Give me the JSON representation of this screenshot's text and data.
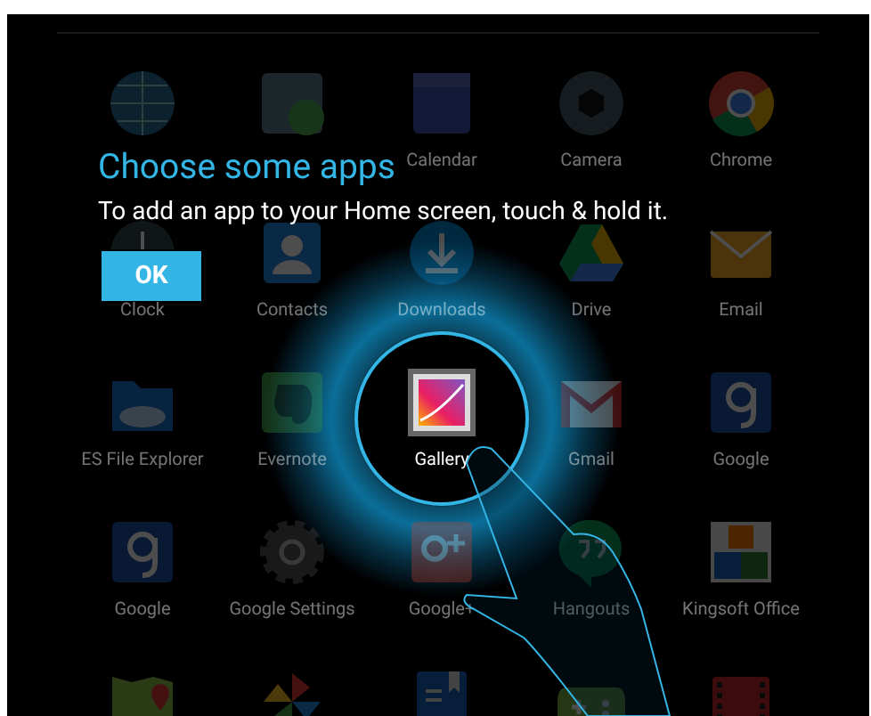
{
  "apps": [
    {
      "highlighted": false
    },
    {
      "highlighted": false
    },
    {
      "label": "Calendar",
      "highlighted": false
    },
    {
      "label": "Camera",
      "highlighted": false
    },
    {
      "label": "Chrome",
      "highlighted": false
    },
    {
      "label": "Clock",
      "highlighted": false
    },
    {
      "label": "Contacts",
      "highlighted": false
    },
    {
      "label": "Downloads",
      "highlighted": false
    },
    {
      "label": "Drive",
      "highlighted": false
    },
    {
      "label": "Email",
      "highlighted": false
    },
    {
      "label": "ES File Explorer",
      "highlighted": false
    },
    {
      "label": "Evernote",
      "highlighted": false
    },
    {
      "label": "Gallery",
      "highlighted": true
    },
    {
      "label": "Gmail",
      "highlighted": false
    },
    {
      "label": "Google",
      "highlighted": false
    },
    {
      "label": "Google",
      "highlighted": false
    },
    {
      "label": "Google Settings",
      "highlighted": false
    },
    {
      "label": "Google+",
      "highlighted": false
    },
    {
      "label": "Hangouts",
      "highlighted": false
    },
    {
      "label": "Kingsoft Office",
      "highlighted": false
    },
    {
      "highlighted": false
    },
    {
      "highlighted": false
    },
    {
      "highlighted": false
    },
    {
      "highlighted": false
    },
    {
      "highlighted": false
    }
  ],
  "tutorial": {
    "title": "Choose some apps",
    "message": "To add an app to your Home screen, touch & hold it.",
    "button": "OK"
  }
}
